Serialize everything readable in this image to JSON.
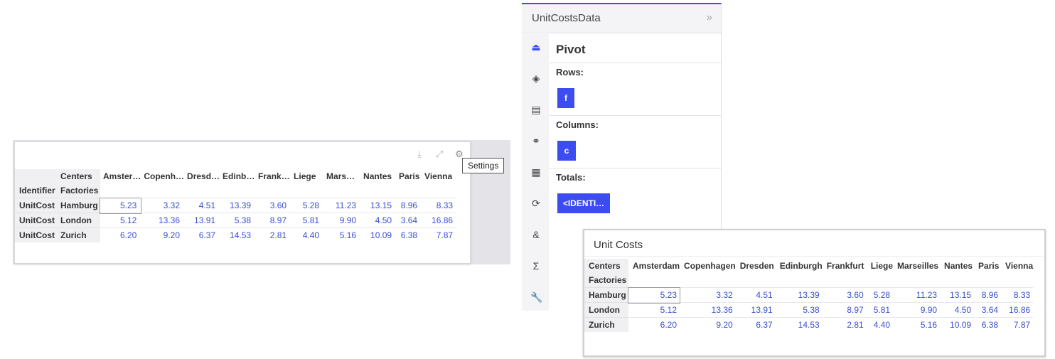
{
  "left_widget": {
    "toolbar": {
      "download": "download-icon",
      "expand": "expand-icon",
      "settings": "gear-icon"
    },
    "tooltip": "Settings",
    "header": {
      "centers": "Centers",
      "factories": "Factories",
      "identifier": "Identifier"
    },
    "columns": [
      "Amster…",
      "Copenh…",
      "Dresd…",
      "Edinb…",
      "Frank…",
      "Liege",
      "Mars…",
      "Nantes",
      "Paris",
      "Vienna"
    ],
    "rows": [
      {
        "identifier": "UnitCost",
        "factory": "Hamburg",
        "values": [
          "5.23",
          "3.32",
          "4.51",
          "13.39",
          "3.60",
          "5.28",
          "11.23",
          "13.15",
          "8.96",
          "8.33"
        ]
      },
      {
        "identifier": "UnitCost",
        "factory": "London",
        "values": [
          "5.12",
          "13.36",
          "13.91",
          "5.38",
          "8.97",
          "5.81",
          "9.90",
          "4.50",
          "3.64",
          "16.86"
        ]
      },
      {
        "identifier": "UnitCost",
        "factory": "Zurich",
        "values": [
          "6.20",
          "9.20",
          "6.37",
          "14.53",
          "2.81",
          "4.40",
          "5.16",
          "10.09",
          "6.38",
          "7.87"
        ]
      }
    ]
  },
  "panel": {
    "title": "UnitCostsData",
    "collapse": "»",
    "pivot_title": "Pivot",
    "rows_label": "Rows:",
    "rows_chip": "f",
    "columns_label": "Columns:",
    "columns_chip": "c",
    "totals_label": "Totals:",
    "totals_chip": "<IDENTI…",
    "rail": [
      "pivot-icon",
      "layers-icon",
      "list-icon",
      "link-icon",
      "table-icon",
      "refresh-icon",
      "ampersand-icon",
      "sigma-icon",
      "wrench-icon"
    ],
    "accent": "#3b4cf0"
  },
  "right_widget": {
    "title": "Unit Costs",
    "header": {
      "centers": "Centers",
      "factories": "Factories"
    },
    "columns": [
      "Amsterdam",
      "Copenhagen",
      "Dresden",
      "Edinburgh",
      "Frankfurt",
      "Liege",
      "Marseilles",
      "Nantes",
      "Paris",
      "Vienna"
    ],
    "rows": [
      {
        "factory": "Hamburg",
        "values": [
          "5.23",
          "3.32",
          "4.51",
          "13.39",
          "3.60",
          "5.28",
          "11.23",
          "13.15",
          "8.96",
          "8.33"
        ]
      },
      {
        "factory": "London",
        "values": [
          "5.12",
          "13.36",
          "13.91",
          "5.38",
          "8.97",
          "5.81",
          "9.90",
          "4.50",
          "3.64",
          "16.86"
        ]
      },
      {
        "factory": "Zurich",
        "values": [
          "6.20",
          "9.20",
          "6.37",
          "14.53",
          "2.81",
          "4.40",
          "5.16",
          "10.09",
          "6.38",
          "7.87"
        ]
      }
    ]
  }
}
